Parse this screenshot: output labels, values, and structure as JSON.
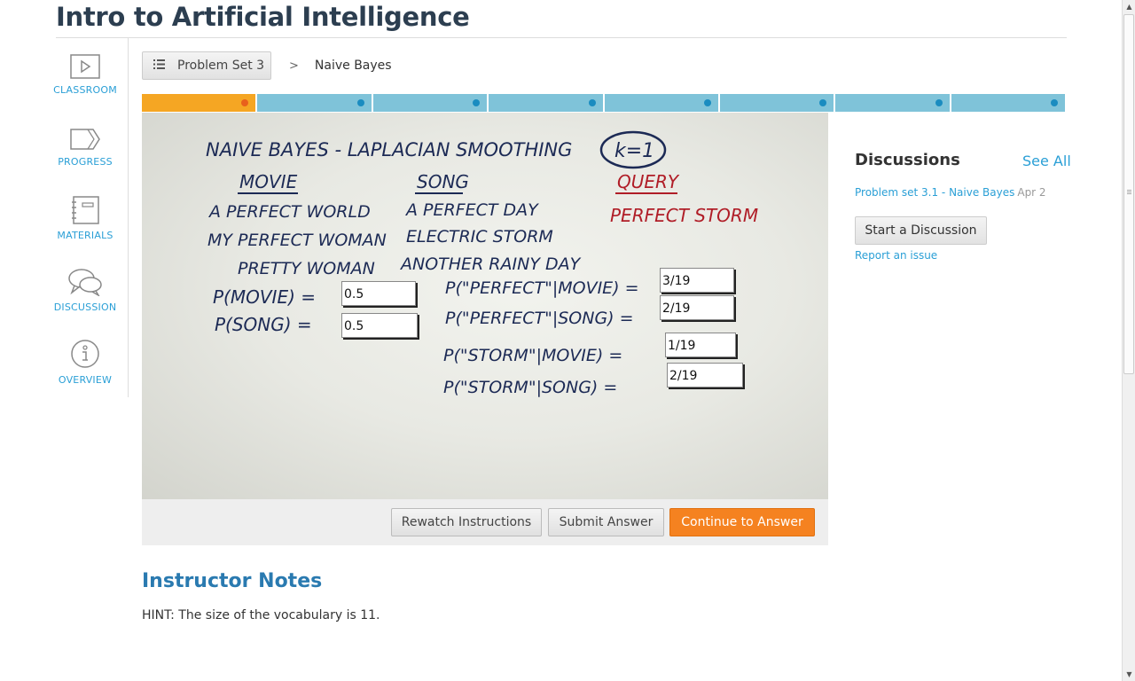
{
  "course": {
    "title": "Intro to Artificial Intelligence"
  },
  "sidenav": {
    "items": [
      {
        "label": "CLASSROOM",
        "icon": "play-icon"
      },
      {
        "label": "PROGRESS",
        "icon": "progress-icon"
      },
      {
        "label": "MATERIALS",
        "icon": "notebook-icon"
      },
      {
        "label": "DISCUSSION",
        "icon": "chat-bubbles-icon"
      },
      {
        "label": "OVERVIEW",
        "icon": "info-icon"
      }
    ]
  },
  "breadcrumb": {
    "problem_set": "Problem Set 3",
    "separator": ">",
    "current": "Naive Bayes"
  },
  "progress": {
    "segments": 8,
    "active_index": 0
  },
  "board": {
    "title": "NAIVE BAYES - LAPLACIAN SMOOTHING",
    "k_label": "k=1",
    "movie_header": "MOVIE",
    "song_header": "SONG",
    "query_header": "QUERY",
    "movies": [
      "A PERFECT WORLD",
      "MY PERFECT WOMAN",
      "PRETTY WOMAN"
    ],
    "songs": [
      "A PERFECT DAY",
      "ELECTRIC STORM",
      "ANOTHER RAINY DAY"
    ],
    "query": "PERFECT STORM",
    "p_movie_label": "P(MOVIE) =",
    "p_song_label": "P(SONG) =",
    "cond1_label": "P(\"PERFECT\"|MOVIE) =",
    "cond2_label": "P(\"PERFECT\"|SONG) =",
    "cond3_label": "P(\"STORM\"|MOVIE) =",
    "cond4_label": "P(\"STORM\"|SONG) ="
  },
  "answers": {
    "p_movie": "0.5",
    "p_song": "0.5",
    "perfect_movie": "3/19",
    "perfect_song": "2/19",
    "storm_movie": "1/19",
    "storm_song": "2/19"
  },
  "controls": {
    "rewatch": "Rewatch Instructions",
    "submit": "Submit Answer",
    "continue": "Continue to Answer"
  },
  "notes": {
    "title": "Instructor Notes",
    "text": "HINT: The size of the vocabulary is 11."
  },
  "discussions": {
    "title": "Discussions",
    "see_all": "See All",
    "thread_title": "Problem set 3.1 - Naive Bayes",
    "thread_date": "Apr 2",
    "start_button": "Start a Discussion",
    "report": "Report an issue"
  },
  "colors": {
    "accent_orange": "#f58220",
    "progress_blue": "#7fc3d9",
    "link_blue": "#2a9fd6",
    "marker_blue": "#1c2a55",
    "marker_red": "#b01d27"
  }
}
